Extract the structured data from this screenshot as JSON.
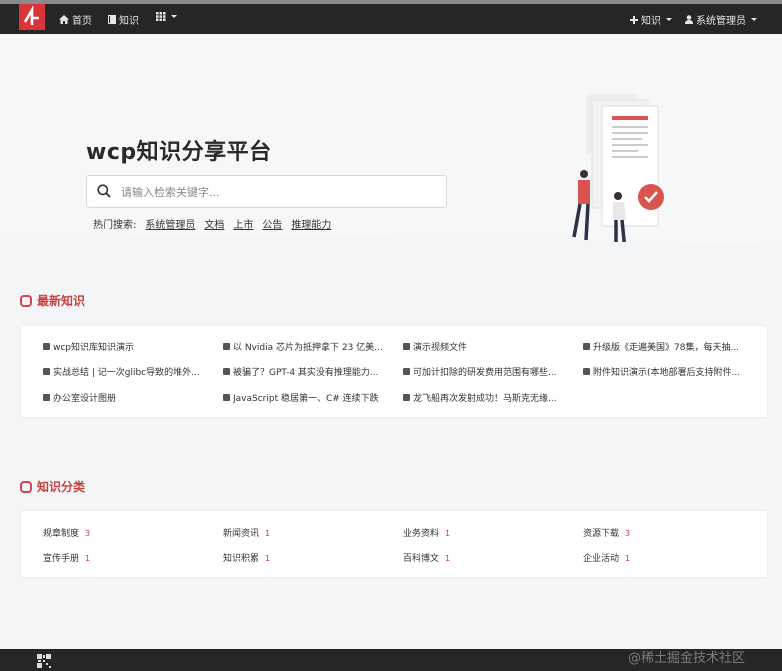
{
  "nav": {
    "home": "首页",
    "knowledge": "知识",
    "add_knowledge": "知识",
    "user": "系统管理员"
  },
  "hero": {
    "title": "wcp知识分享平台",
    "search_placeholder": "请输入检索关键字...",
    "hot_label": "热门搜索:",
    "hot_terms": [
      "系统管理员",
      "文档",
      "上市",
      "公告",
      "推理能力"
    ]
  },
  "latest": {
    "title": "最新知识",
    "rows": [
      [
        "wcp知识库知识演示",
        "以 Nvidia 芯片为抵押拿下 23 亿美...",
        "演示视频文件",
        "升级版《走遍美国》78集，每天抽..."
      ],
      [
        "实战总结 | 记一次glibc导致的堆外...",
        "被骗了？GPT-4 其实没有推理能力...",
        "可加计扣除的研发费用范围有哪些...",
        "附件知识演示(本地部署后支持附件..."
      ],
      [
        "办公室设计图册",
        "JavaScript 稳居第一、C# 连续下跌",
        "龙飞船再次发射成功！马斯克无缘..."
      ]
    ]
  },
  "categories": {
    "title": "知识分类",
    "rows": [
      [
        {
          "name": "规章制度",
          "count": "3"
        },
        {
          "name": "新闻资讯",
          "count": "1"
        },
        {
          "name": "业务资料",
          "count": "1"
        },
        {
          "name": "资源下载",
          "count": "3"
        }
      ],
      [
        {
          "name": "宣传手册",
          "count": "1"
        },
        {
          "name": "知识积累",
          "count": "1"
        },
        {
          "name": "百科博文",
          "count": "1"
        },
        {
          "name": "企业活动",
          "count": "1"
        }
      ]
    ]
  },
  "watermark": "@稀土掘金技术社区",
  "colors": {
    "accent": "#d9343a",
    "navbar": "#262626"
  }
}
